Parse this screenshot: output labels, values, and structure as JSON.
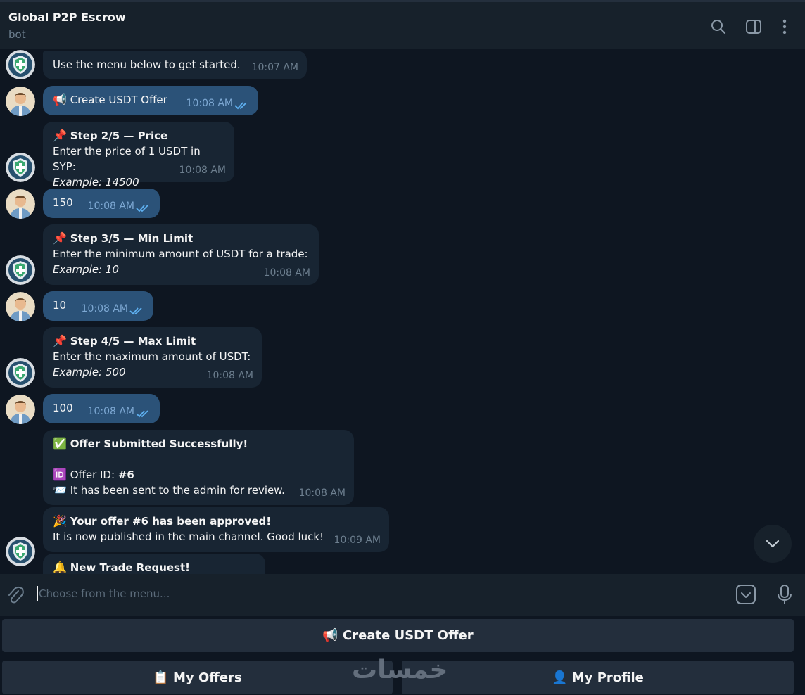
{
  "header": {
    "title": "Global P2P Escrow",
    "subtitle": "bot"
  },
  "messages": {
    "m1": {
      "text": "Use the menu below to get started.",
      "time": "10:07 AM"
    },
    "m2": {
      "emoji": "📢",
      "text": "Create USDT Offer",
      "time": "10:08 AM"
    },
    "m3": {
      "emoji": "📌",
      "title": "Step 2/5 — Price",
      "line": "Enter the price of 1 USDT in SYP:",
      "example": "Example: 14500",
      "time": "10:08 AM"
    },
    "m4": {
      "text": "150",
      "time": "10:08 AM"
    },
    "m5": {
      "emoji": "📌",
      "title": "Step 3/5 — Min Limit",
      "line": "Enter the minimum amount of USDT for a trade:",
      "example": "Example: 10",
      "time": "10:08 AM"
    },
    "m6": {
      "text": "10",
      "time": "10:08 AM"
    },
    "m7": {
      "emoji": "📌",
      "title": "Step 4/5 — Max Limit",
      "line": "Enter the maximum amount of USDT:",
      "example": "Example: 500",
      "time": "10:08 AM"
    },
    "m8": {
      "text": "100",
      "time": "10:08 AM"
    },
    "m9": {
      "emoji1": "✅",
      "title": "Offer Submitted Successfully!",
      "emoji2": "🆔",
      "id_label": "Offer ID: ",
      "id_value": "#6",
      "emoji3": "📨",
      "line": "It has been sent to the admin for review.",
      "time": "10:08 AM"
    },
    "m10": {
      "emoji": "🎉",
      "title": "Your offer #6 has been approved!",
      "line": "It is now published in the main channel. Good luck!",
      "time": "10:09 AM"
    },
    "m11": {
      "emoji": "🔔",
      "title": "New Trade Request!"
    }
  },
  "composer": {
    "placeholder": "Choose from the menu..."
  },
  "keyboard": {
    "create_offer": "📢 Create USDT Offer",
    "my_offers": "📋 My Offers",
    "my_profile": "👤 My Profile"
  },
  "watermark": "خمسات",
  "colors": {
    "background": "#0e1621",
    "incoming_bubble": "#182533",
    "outgoing_bubble": "#2b5278",
    "panel": "#17212b",
    "keyboard_button": "#232e3c",
    "read_ticks": "#5fb0f0"
  },
  "icons": [
    "search-icon",
    "sidebar-toggle-icon",
    "more-vert-icon",
    "bot-shield-avatar",
    "user-avatar",
    "read-ticks-icon",
    "chevron-down-icon",
    "paperclip-icon",
    "keyboard-icon",
    "microphone-icon"
  ]
}
